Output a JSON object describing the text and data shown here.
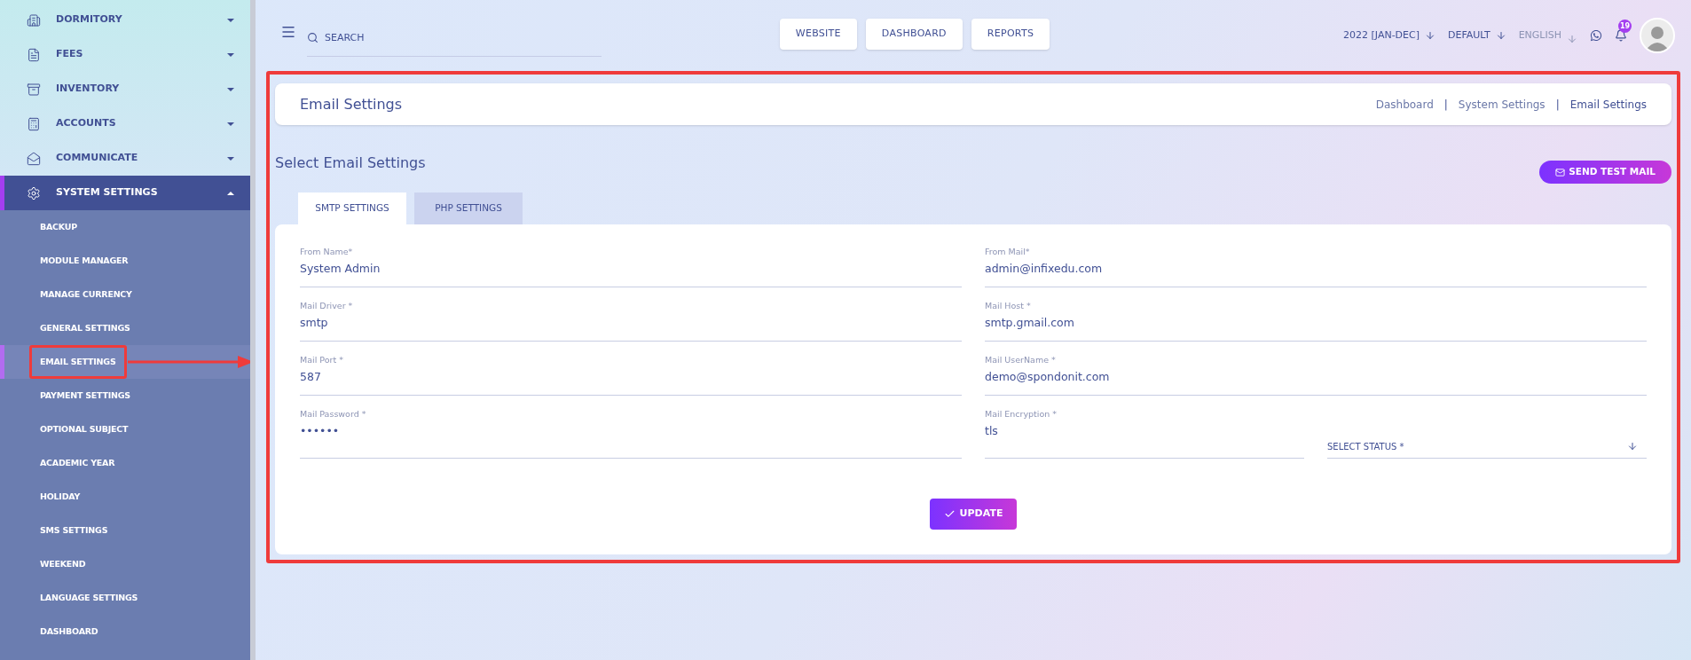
{
  "sidebar": {
    "items": [
      {
        "label": "DORMITORY",
        "expanded": false
      },
      {
        "label": "FEES",
        "expanded": false
      },
      {
        "label": "INVENTORY",
        "expanded": false
      },
      {
        "label": "ACCOUNTS",
        "expanded": false
      },
      {
        "label": "COMMUNICATE",
        "expanded": false
      },
      {
        "label": "SYSTEM SETTINGS",
        "expanded": true,
        "children": [
          {
            "label": "BACKUP",
            "selected": false
          },
          {
            "label": "MODULE MANAGER",
            "selected": false
          },
          {
            "label": "MANAGE CURRENCY",
            "selected": false
          },
          {
            "label": "GENERAL SETTINGS",
            "selected": false
          },
          {
            "label": "EMAIL SETTINGS",
            "selected": true
          },
          {
            "label": "PAYMENT SETTINGS",
            "selected": false
          },
          {
            "label": "OPTIONAL SUBJECT",
            "selected": false
          },
          {
            "label": "ACADEMIC YEAR",
            "selected": false
          },
          {
            "label": "HOLIDAY",
            "selected": false
          },
          {
            "label": "SMS SETTINGS",
            "selected": false
          },
          {
            "label": "WEEKEND",
            "selected": false
          },
          {
            "label": "LANGUAGE SETTINGS",
            "selected": false
          },
          {
            "label": "DASHBOARD",
            "selected": false
          }
        ]
      }
    ]
  },
  "topbar": {
    "search": {
      "placeholder": "SEARCH"
    },
    "nav_buttons": [
      "WEBSITE",
      "DASHBOARD",
      "REPORTS"
    ],
    "selectors": [
      "2022 [JAN-DEC]",
      "DEFAULT",
      "ENGLISH"
    ],
    "notification_count": "19"
  },
  "page": {
    "title": "Email Settings",
    "breadcrumbs": [
      "Dashboard",
      "System Settings",
      "Email Settings"
    ],
    "breadcrumb_separator": "|",
    "section_title": "Select Email Settings",
    "send_button": "SEND TEST MAIL",
    "tabs": [
      {
        "label": "SMTP SETTINGS",
        "selected": true
      },
      {
        "label": "PHP SETTINGS",
        "selected": false
      }
    ],
    "rows": [
      [
        {
          "kind": "text",
          "label": "From Name*",
          "value": "System Admin"
        },
        {
          "kind": "text",
          "label": "From Mail*",
          "value": "admin@infixedu.com"
        }
      ],
      [
        {
          "kind": "text",
          "label": "Mail Driver *",
          "value": "smtp"
        },
        {
          "kind": "text",
          "label": "Mail Host *",
          "value": "smtp.gmail.com"
        }
      ],
      [
        {
          "kind": "text",
          "label": "Mail Port *",
          "value": "587"
        },
        {
          "kind": "text",
          "label": "Mail UserName *",
          "value": "demo@spondonit.com"
        }
      ],
      [
        {
          "kind": "text",
          "label": "Mail Password *",
          "value": "••••••"
        },
        {
          "kind": "text",
          "label": "Mail Encryption *",
          "value": "tls"
        },
        {
          "kind": "select",
          "placeholder": "SELECT STATUS *"
        }
      ]
    ],
    "update_button": "UPDATE"
  }
}
